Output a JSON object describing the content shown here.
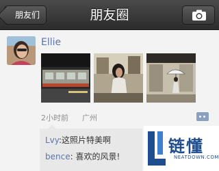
{
  "navbar": {
    "back_label": "朋友们",
    "title": "朋友圈",
    "camera_icon": "camera-icon"
  },
  "post": {
    "username": "Ellie",
    "photos_count": 3,
    "time": "2小时前",
    "location": "广州",
    "comment_icon": "comment-icon"
  },
  "comments": [
    {
      "author": "Lvy",
      "text": ":这照片特美啊"
    },
    {
      "author": "bence",
      "text": ": 喜欢的风景!"
    }
  ],
  "watermark": {
    "name": "链懂",
    "domain": "NEATDOWN.COM"
  }
}
